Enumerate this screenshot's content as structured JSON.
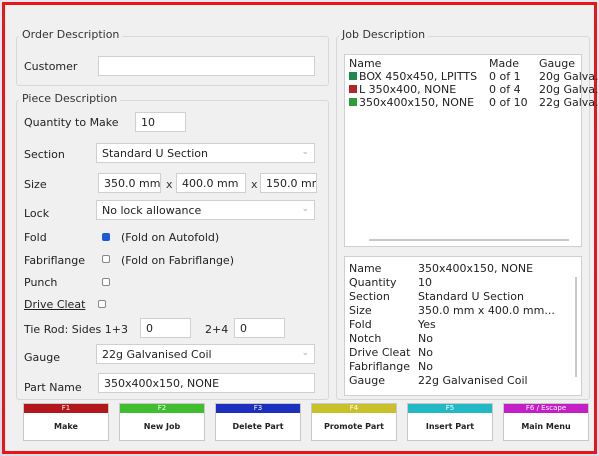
{
  "order": {
    "title": "Order Description",
    "customer_label": "Customer",
    "customer_value": ""
  },
  "piece": {
    "title": "Piece Description",
    "quantity_label": "Quantity to Make",
    "quantity_value": "10",
    "section_label": "Section",
    "section_value": "Standard U Section",
    "size_label": "Size",
    "size_a": "350.0 mm",
    "size_b": "400.0 mm",
    "size_c": "150.0 mm",
    "x_symbol": "x",
    "lock_label": "Lock",
    "lock_value": "No lock allowance",
    "fold_label": "Fold",
    "fold_note": "(Fold on Autofold)",
    "fabriflange_label": "Fabriflange",
    "fabriflange_note": "(Fold on Fabriflange)",
    "punch_label": "Punch",
    "drive_cleat_label": "Drive Cleat",
    "tie_rod_label": "Tie Rod: Sides 1+3",
    "tie_rod_13_value": "0",
    "tie_rod_24_label": "2+4",
    "tie_rod_24_value": "0",
    "gauge_label": "Gauge",
    "gauge_value": "22g Galvanised Coil",
    "part_name_label": "Part Name",
    "part_name_value": "350x400x150, NONE"
  },
  "job": {
    "title": "Job Description",
    "columns": [
      "Name",
      "Made",
      "Gauge"
    ],
    "rows": [
      {
        "icon": "box-part-icon",
        "color": "#1f8a4c",
        "name": "BOX 450x450, LPITTS",
        "made": "0 of 1",
        "gauge": "20g Galva."
      },
      {
        "icon": "l-part-icon",
        "color": "#b0262b",
        "name": "L 350x400, NONE",
        "made": "0 of 4",
        "gauge": "20g Galva."
      },
      {
        "icon": "u-part-icon",
        "color": "#2f9c3a",
        "name": "350x400x150, NONE",
        "made": "0 of 10",
        "gauge": "22g Galva."
      }
    ]
  },
  "details": [
    {
      "k": "Name",
      "v": "350x400x150, NONE"
    },
    {
      "k": "Quantity",
      "v": "10"
    },
    {
      "k": "Section",
      "v": "Standard U Section"
    },
    {
      "k": "Size",
      "v": "350.0 mm x 400.0 mm..."
    },
    {
      "k": "Fold",
      "v": "Yes"
    },
    {
      "k": "Notch",
      "v": "No"
    },
    {
      "k": "Drive Cleat",
      "v": "No"
    },
    {
      "k": "Fabriflange",
      "v": "No"
    },
    {
      "k": "Gauge",
      "v": "22g Galvanised Coil"
    }
  ],
  "fkeys": [
    {
      "key": "F1",
      "label": "Make",
      "color": "#b3161b"
    },
    {
      "key": "F2",
      "label": "New Job",
      "color": "#3fbf2f"
    },
    {
      "key": "F3",
      "label": "Delete Part",
      "color": "#1d2fbf"
    },
    {
      "key": "F4",
      "label": "Promote Part",
      "color": "#c9c12a"
    },
    {
      "key": "F5",
      "label": "Insert Part",
      "color": "#22b8c4"
    },
    {
      "key": "F6 / Escape",
      "label": "Main Menu",
      "color": "#c41fc6"
    }
  ]
}
